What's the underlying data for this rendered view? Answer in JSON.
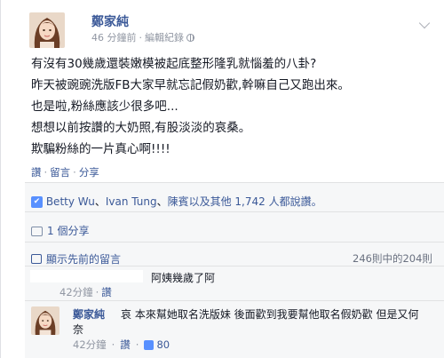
{
  "post": {
    "author": "鄭家純",
    "timestamp": "46 分鐘前",
    "meta_sep": "·",
    "edit_history": "編輯紀錄",
    "privacy_icon": "globe-icon",
    "menu_icon": "chevron-down-icon",
    "lines": [
      "有沒有30幾歲還裝嫩模被起底整形隆乳就惱羞的八卦?",
      "昨天被豌豌洗版FB大家早就忘記假奶歡,幹嘛自己又跑出來。",
      "也是啦,粉絲應該少很多吧...",
      "想想以前按讚的大奶照,有股淡淡的哀桑。",
      "欺騙粉絲的一片真心啊!!!!"
    ]
  },
  "actions": {
    "like": "讚",
    "comment": "留言",
    "share": "分享",
    "sep": "·"
  },
  "ufi": {
    "likers_1": "Betty Wu",
    "likers_2": "Ivan Tung",
    "likers_3": "陳賓以及其他 1,742 人都說讚。",
    "likers_sep": "、",
    "shares": "1 個分享",
    "view_previous": "顯示先前的留言",
    "comment_count": "246則中的204則"
  },
  "comments": [
    {
      "author": "",
      "text": "阿姨幾歲了阿",
      "time": "42分鐘",
      "like_label": "讚"
    },
    {
      "author": "鄭家純",
      "text_line1": "哀 本來幫她取名洗版妹 後面歡到我要幫他取名假奶歡 但是又何",
      "text_line2": "奈",
      "time": "42分鐘",
      "like_label": "讚",
      "like_count": "80"
    }
  ],
  "colors": {
    "link": "#3b5998",
    "muted": "#9197a3",
    "like_blue": "#5890ff",
    "ufi_bg": "#f6f7f8"
  }
}
